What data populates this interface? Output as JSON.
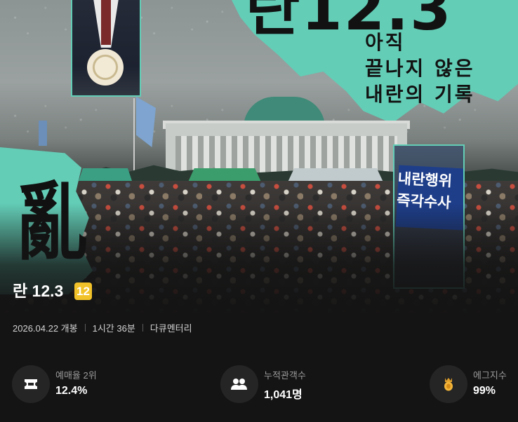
{
  "poster": {
    "big_title": "란12.3",
    "tagline": "아직\n끝나지 않은\n내란의 기록",
    "calligraphy": "亂",
    "protest_sign": "내란행위\n즉각수사"
  },
  "movie": {
    "title": "란 12.3",
    "rating_badge": "12",
    "rating_color": "#f2c22a",
    "release": "2026.04.22 개봉",
    "runtime": "1시간 36분",
    "genre": "다큐멘터리"
  },
  "stats": [
    {
      "icon": "ticket-icon",
      "label": "예매율 2위",
      "value": "12.4%"
    },
    {
      "icon": "audience-icon",
      "label": "누적관객수",
      "value": "1,041명"
    },
    {
      "icon": "egg-icon",
      "label": "에그지수",
      "value": "99%"
    }
  ],
  "colors": {
    "accent_mint": "#63cdb6",
    "background": "#141414"
  }
}
